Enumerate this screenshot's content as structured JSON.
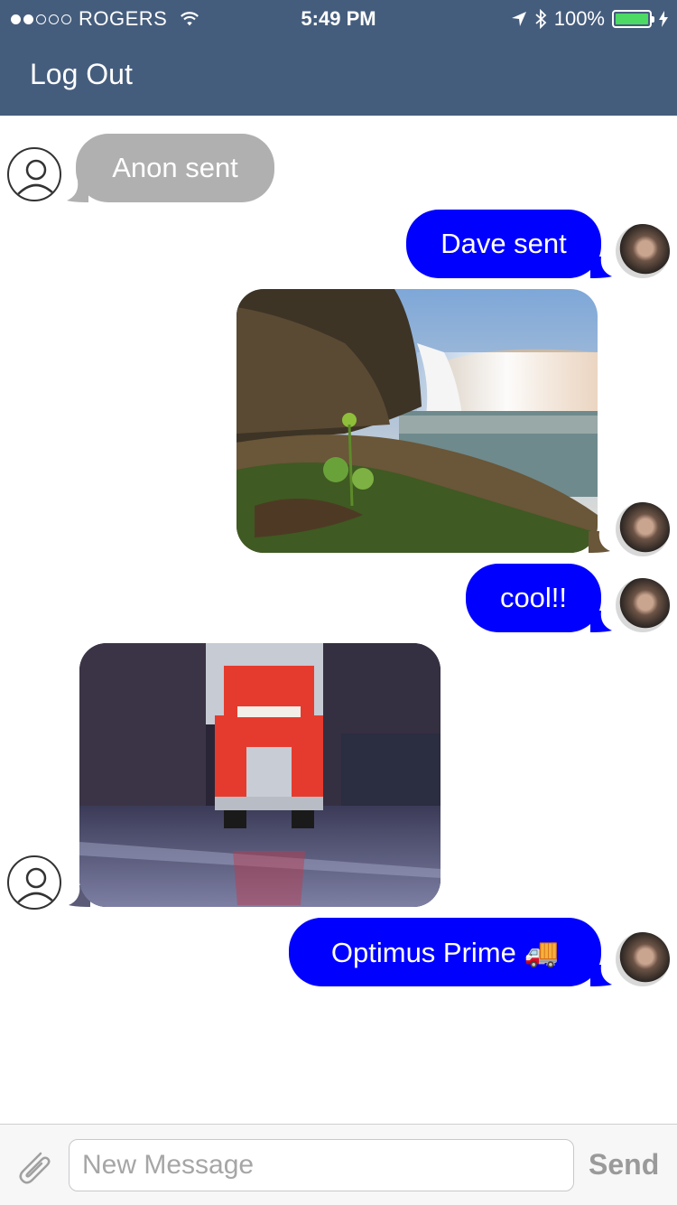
{
  "status_bar": {
    "carrier": "ROGERS",
    "time": "5:49 PM",
    "battery": "100%"
  },
  "nav": {
    "logout_label": "Log Out"
  },
  "messages": [
    {
      "sender": "Anon",
      "direction": "incoming",
      "text": "Anon sent"
    },
    {
      "sender": "Dave",
      "direction": "outgoing",
      "text": "Dave sent"
    },
    {
      "sender": "Dave",
      "direction": "outgoing",
      "type": "image",
      "subject": "waterfall"
    },
    {
      "sender": "Dave",
      "direction": "outgoing",
      "text": "cool!!"
    },
    {
      "sender": "Anon",
      "direction": "incoming",
      "type": "image",
      "subject": "red truck in alley"
    },
    {
      "sender": "Dave",
      "direction": "outgoing",
      "text": "Optimus Prime 🚚"
    }
  ],
  "composer": {
    "placeholder": "New Message",
    "send_label": "Send",
    "attach_icon": "paperclip-icon"
  },
  "colors": {
    "nav_bg": "#455d7d",
    "outgoing_bubble": "#0000ff",
    "incoming_bubble": "#b0b0b0",
    "battery_fill": "#4cd964"
  }
}
